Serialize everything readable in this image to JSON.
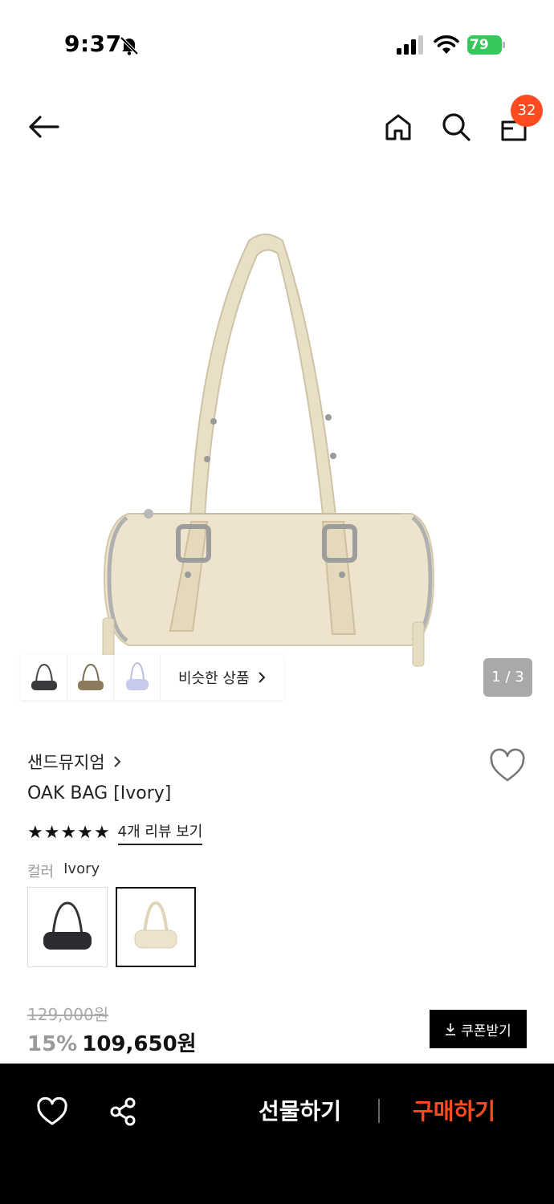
{
  "status": {
    "time": "9:37",
    "battery": "79"
  },
  "nav": {
    "cart_count": "32"
  },
  "gallery": {
    "similar_label": "비슷한 상품",
    "pager": "1 / 3"
  },
  "product": {
    "brand": "샌드뮤지엄",
    "name": "OAK BAG [Ivory]",
    "rating_stars": 5,
    "review_link": "4개 리뷰 보기",
    "color_label": "컬러",
    "color_value": "Ivory",
    "original_price": "129,000원",
    "discount": "15%",
    "price": "109,650원",
    "coupon_label": "쿠폰받기"
  },
  "bottom": {
    "gift_label": "선물하기",
    "buy_label": "구매하기"
  },
  "colors": {
    "accent": "#ff4b1f",
    "bag_ivory": "#ede3cc",
    "battery_green": "#35c759"
  }
}
